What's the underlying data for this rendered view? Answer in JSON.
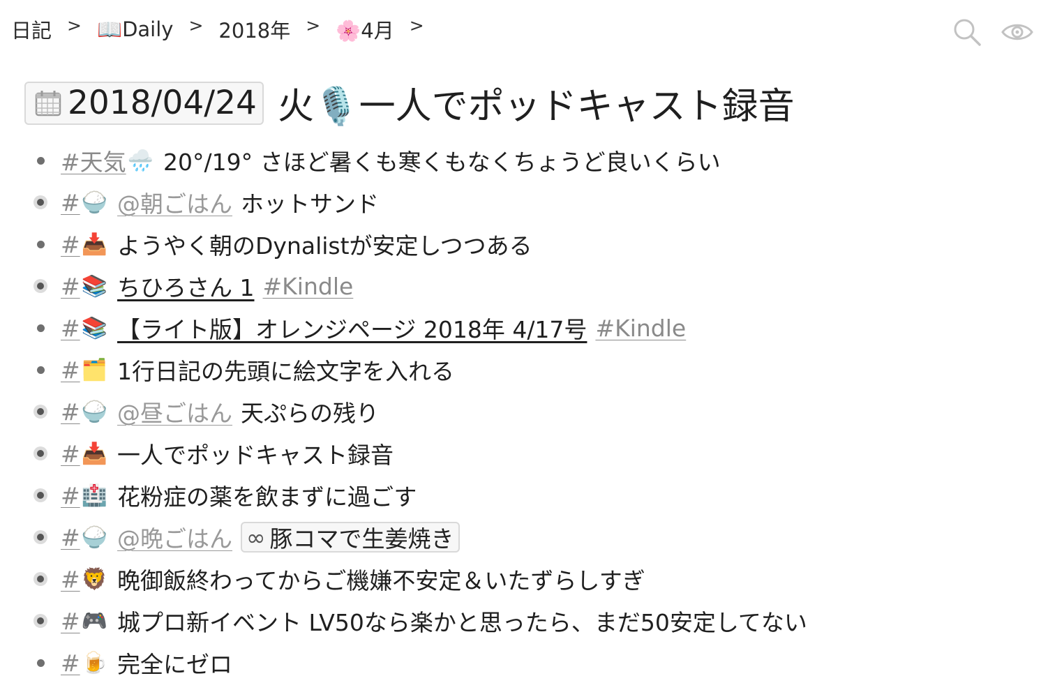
{
  "breadcrumb": {
    "items": [
      {
        "label": "日記"
      },
      {
        "label": "📖Daily"
      },
      {
        "label": "2018年"
      },
      {
        "label": "🌸4月"
      }
    ],
    "separator": ">"
  },
  "title": {
    "date": "2018/04/24",
    "text": "火🎙️一人でポッドキャスト録音"
  },
  "items": [
    {
      "tag": "#天気",
      "emoji": "🌧️",
      "text": "20°/19° さほど暑くも寒くもなくちょうど良いくらい",
      "collapsed": false
    },
    {
      "tag": "#",
      "emoji": "🍚",
      "mention": "@朝ごはん",
      "text": "ホットサンド",
      "collapsed": true
    },
    {
      "tag": "#",
      "emoji": "📥",
      "text": "ようやく朝のDynalistが安定しつつある",
      "collapsed": false
    },
    {
      "tag": "#",
      "emoji": "📚",
      "link": "ちひろさん 1",
      "tag2": "#Kindle",
      "collapsed": true
    },
    {
      "tag": "#",
      "emoji": "📚",
      "link": "【ライト版】オレンジページ 2018年 4/17号",
      "tag2": "#Kindle",
      "collapsed": false
    },
    {
      "tag": "#",
      "emoji": "🗂️",
      "text": "1行日記の先頭に絵文字を入れる",
      "collapsed": false
    },
    {
      "tag": "#",
      "emoji": "🍚",
      "mention": "@昼ごはん",
      "text": "天ぷらの残り",
      "collapsed": true
    },
    {
      "tag": "#",
      "emoji": "📥",
      "text": "一人でポッドキャスト録音",
      "collapsed": true
    },
    {
      "tag": "#",
      "emoji": "🏥",
      "text": "花粉症の薬を飲まずに過ごす",
      "collapsed": true
    },
    {
      "tag": "#",
      "emoji": "🍚",
      "mention": "@晩ごはん",
      "chip": "豚コマで生姜焼き",
      "chip_icon": "∞",
      "collapsed": true
    },
    {
      "tag": "#",
      "emoji": "🦁",
      "text": "晩御飯終わってからご機嫌不安定＆いたずらしすぎ",
      "collapsed": true
    },
    {
      "tag": "#",
      "emoji": "🎮",
      "text": "城プロ新イベント LV50なら楽かと思ったら、まだ50安定してない",
      "collapsed": true
    },
    {
      "tag": "#",
      "emoji": "🍺",
      "text": "完全にゼロ",
      "collapsed": false
    }
  ]
}
